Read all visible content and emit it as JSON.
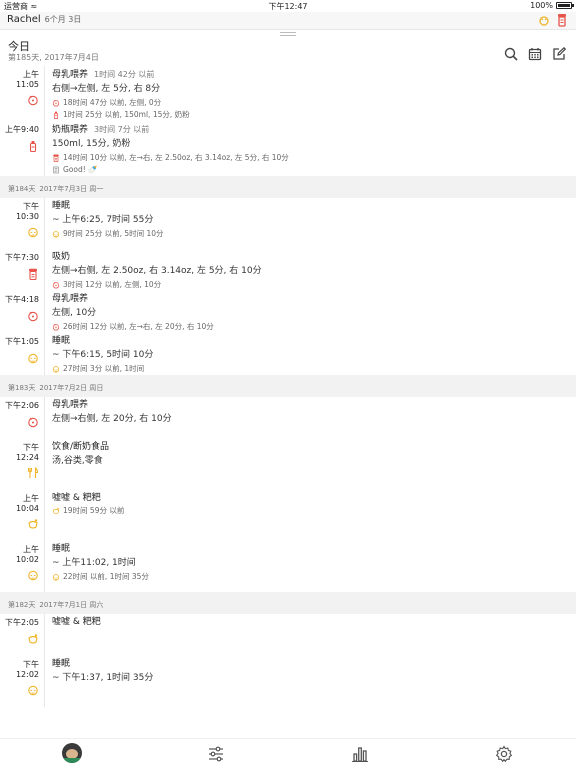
{
  "status_bar": {
    "carrier": "运营商 ≈",
    "time": "下午12:47",
    "battery": "100%",
    "battery_level": 1.0
  },
  "top_bar": {
    "baby_name": "Rachel",
    "age": "6个月 3日"
  },
  "header": {
    "title": "今日",
    "subtitle": "第185天, 2017年7月4日"
  },
  "colors": {
    "accent": "#e8534a",
    "sleep": "#f0b429",
    "timeline": "#e8e8e8"
  },
  "entries": [
    {
      "time": "上午11:05",
      "icon": "breastfeed-icon",
      "title": "母乳喂养",
      "ago": "1时间 42分 以前",
      "main": "右侧→左侧, 左 5分, 右 8分",
      "notes": [
        {
          "icon": "breastfeed-icon",
          "text": "18时间 47分 以前, 左侧, 0分"
        },
        {
          "icon": "bottle-icon",
          "text": "1时间 25分 以前, 150ml, 15分, 奶粉"
        }
      ]
    },
    {
      "time": "上午9:40",
      "icon": "bottle-icon",
      "title": "奶瓶喂养",
      "ago": "3时间 7分 以前",
      "main": "150ml, 15分, 奶粉",
      "notes": [
        {
          "icon": "pump-icon",
          "text": "14时间 10分 以前, 左→右, 左 2.50oz, 右 3.14oz, 左 5分, 右 10分"
        },
        {
          "icon": "memo-icon",
          "text": "Good! 🍼"
        }
      ]
    }
  ],
  "day_184": {
    "label": "第184天",
    "date": "2017年7月3日 周一"
  },
  "entries_184": [
    {
      "time": "下午10:30",
      "icon": "sleep-icon",
      "title": "睡眠",
      "main": "~ 上午6:25, 7时间 55分",
      "notes": [
        {
          "icon": "sleep-icon",
          "text": "9时间 25分 以前, 5时间 10分"
        }
      ]
    },
    {
      "time": "下午7:30",
      "icon": "pump-icon",
      "title": "吸奶",
      "main": "左侧→右侧, 左 2.50oz, 右 3.14oz, 左 5分, 右 10分",
      "notes": [
        {
          "icon": "breastfeed-icon",
          "text": "3时间 12分 以前, 左侧, 10分"
        }
      ]
    },
    {
      "time": "下午4:18",
      "icon": "breastfeed-icon",
      "title": "母乳喂养",
      "main": "左侧, 10分",
      "notes": [
        {
          "icon": "breastfeed-icon",
          "text": "26时间 12分 以前, 左→右, 左 20分, 右 10分"
        }
      ]
    },
    {
      "time": "下午1:05",
      "icon": "sleep-icon",
      "title": "睡眠",
      "main": "~ 下午6:15, 5时间 10分",
      "notes": [
        {
          "icon": "sleep-icon",
          "text": "27时间 3分 以前, 1时间"
        }
      ]
    }
  ],
  "day_183": {
    "label": "第183天",
    "date": "2017年7月2日 周日"
  },
  "entries_183": [
    {
      "time": "下午2:06",
      "icon": "breastfeed-icon",
      "title": "母乳喂养",
      "main": "左侧→右侧, 左 20分, 右 10分",
      "notes": []
    },
    {
      "time": "下午12:24",
      "icon": "food-icon",
      "title": "饮食/断奶食品",
      "main": "汤,谷类,零食",
      "notes": []
    },
    {
      "time": "上午10:04",
      "icon": "diaper-icon",
      "title": "嘘嘘 & 粑粑",
      "main": "",
      "notes": [
        {
          "icon": "diaper-icon",
          "text": "19时间 59分 以前"
        }
      ]
    },
    {
      "time": "上午10:02",
      "icon": "sleep-icon",
      "title": "睡眠",
      "main": "~ 上午11:02, 1时间",
      "notes": [
        {
          "icon": "sleep-icon",
          "text": "22时间 以前, 1时间 35分"
        }
      ]
    }
  ],
  "day_182": {
    "label": "第182天",
    "date": "2017年7月1日 周六"
  },
  "entries_182": [
    {
      "time": "下午2:05",
      "icon": "diaper-icon",
      "title": "嘘嘘 & 粑粑",
      "main": "",
      "notes": []
    },
    {
      "time": "下午12:02",
      "icon": "sleep-icon",
      "title": "睡眠",
      "main": "~ 下午1:37, 1时间 35分",
      "notes": []
    }
  ]
}
